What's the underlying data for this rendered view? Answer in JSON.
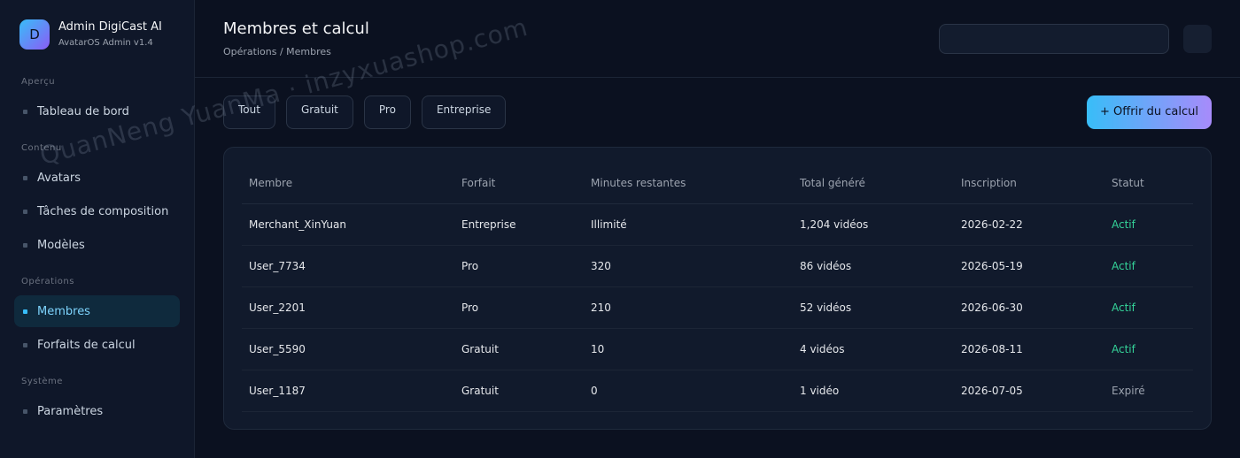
{
  "brand": {
    "logo_letter": "D",
    "title": "Admin DigiCast AI",
    "subtitle": "AvatarOS Admin v1.4"
  },
  "sidebar": {
    "sections": [
      {
        "label": "Aperçu",
        "items": [
          {
            "label": "Tableau de bord",
            "active": false
          }
        ]
      },
      {
        "label": "Contenu",
        "items": [
          {
            "label": "Avatars",
            "active": false
          },
          {
            "label": "Tâches de composition",
            "active": false
          },
          {
            "label": "Modèles",
            "active": false
          }
        ]
      },
      {
        "label": "Opérations",
        "items": [
          {
            "label": "Membres",
            "active": true
          },
          {
            "label": "Forfaits de calcul",
            "active": false
          }
        ]
      },
      {
        "label": "Système",
        "items": [
          {
            "label": "Paramètres",
            "active": false
          }
        ]
      }
    ]
  },
  "header": {
    "title": "Membres et calcul",
    "breadcrumb": "Opérations / Membres"
  },
  "filters": [
    "Tout",
    "Gratuit",
    "Pro",
    "Entreprise"
  ],
  "toolbar": {
    "offer_label": "+ Offrir du calcul"
  },
  "table": {
    "columns": [
      "Membre",
      "Forfait",
      "Minutes restantes",
      "Total généré",
      "Inscription",
      "Statut"
    ],
    "rows": [
      {
        "member": "Merchant_XinYuan",
        "plan": "Entreprise",
        "minutes": "Illimité",
        "total": "1,204 vidéos",
        "joined": "2026-02-22",
        "status": "Actif"
      },
      {
        "member": "User_7734",
        "plan": "Pro",
        "minutes": "320",
        "total": "86 vidéos",
        "joined": "2026-05-19",
        "status": "Actif"
      },
      {
        "member": "User_2201",
        "plan": "Pro",
        "minutes": "210",
        "total": "52 vidéos",
        "joined": "2026-06-30",
        "status": "Actif"
      },
      {
        "member": "User_5590",
        "plan": "Gratuit",
        "minutes": "10",
        "total": "4 vidéos",
        "joined": "2026-08-11",
        "status": "Actif"
      },
      {
        "member": "User_1187",
        "plan": "Gratuit",
        "minutes": "0",
        "total": "1 vidéo",
        "joined": "2026-07-05",
        "status": "Expiré"
      }
    ]
  },
  "watermark": "QuanNeng YuanMa · inzyxuashop.com",
  "colors": {
    "accent": "#38bdf8",
    "active_status": "#34d399",
    "expired_status": "#9ca3af"
  }
}
